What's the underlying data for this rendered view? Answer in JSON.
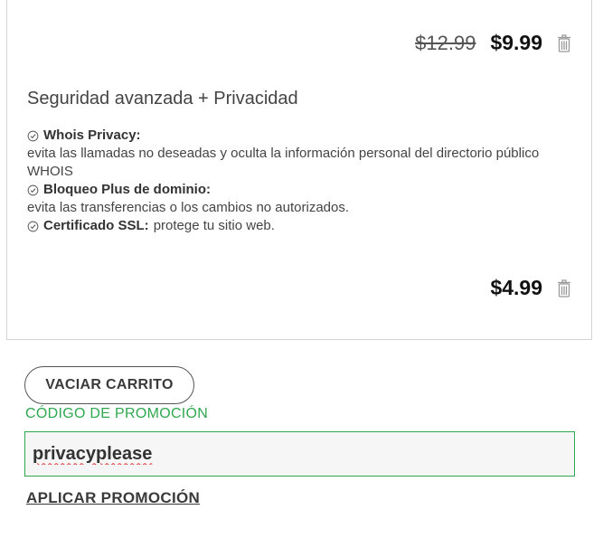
{
  "cart": {
    "item1": {
      "old_price": "$12.99",
      "price": "$9.99"
    },
    "item2": {
      "title": "Seguridad avanzada + Privacidad",
      "features": [
        {
          "label": "Whois Privacy:",
          "text": "evita las llamadas no deseadas y oculta la información personal del directorio público WHOIS",
          "inline": false
        },
        {
          "label": "Bloqueo Plus de dominio:",
          "text": "evita las transferencias o los cambios no autorizados.",
          "inline": false
        },
        {
          "label": "Certificado SSL:",
          "text": "protege tu sitio web.",
          "inline": true
        }
      ],
      "price": "$4.99"
    },
    "empty_cart_label": "VACIAR CARRITO"
  },
  "promo": {
    "label": "CÓDIGO DE PROMOCIÓN",
    "value": "privacyplease",
    "apply_label": "APLICAR PROMOCIÓN"
  },
  "colors": {
    "accent_green": "#2fa84f",
    "spellcheck_red": "#e03030"
  },
  "icons": {
    "delete": "trash-icon",
    "feature": "check-circle-icon"
  }
}
